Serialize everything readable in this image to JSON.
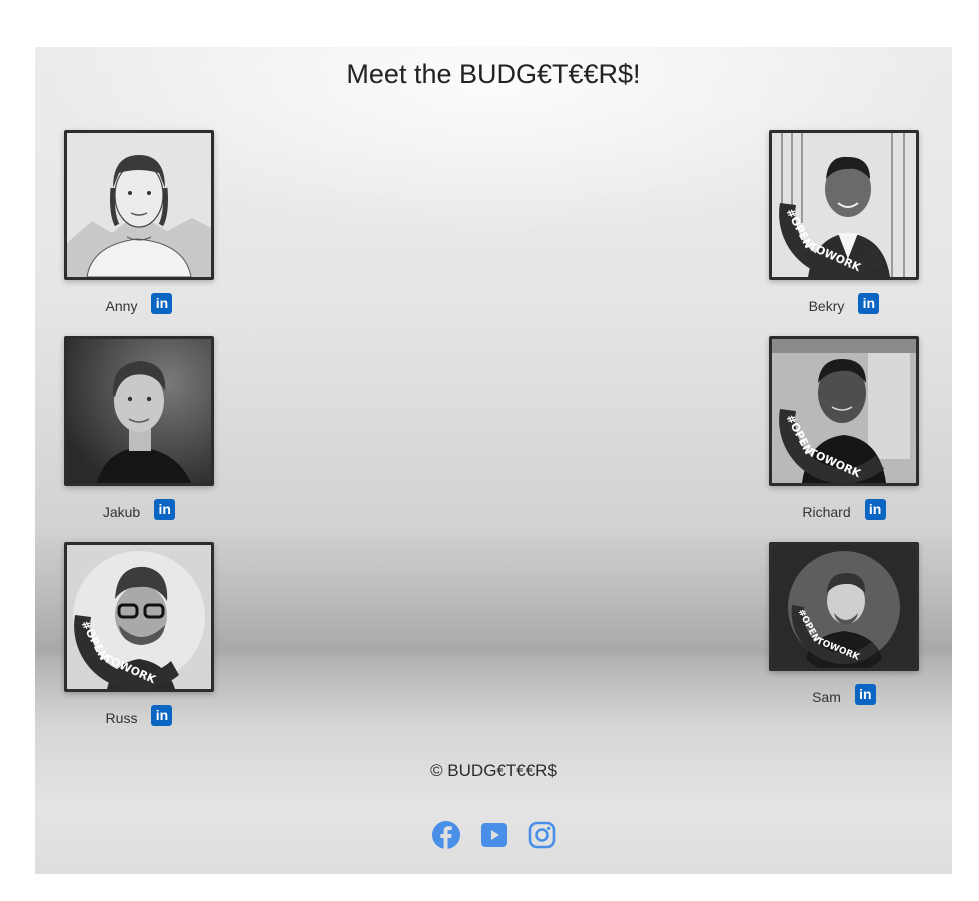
{
  "page": {
    "title": "Meet the BUDG€T€€R$!",
    "copyright": "© BUDG€T€€R$"
  },
  "members": [
    {
      "name": "Anny",
      "linkedin_icon": "linkedin-icon",
      "photo": "illustrated portrait"
    },
    {
      "name": "Jakub",
      "linkedin_icon": "linkedin-icon",
      "photo": "portrait"
    },
    {
      "name": "Russ",
      "linkedin_icon": "linkedin-icon",
      "photo": "portrait",
      "badge": "#OPENTOWORK"
    },
    {
      "name": "Bekry",
      "linkedin_icon": "linkedin-icon",
      "photo": "portrait",
      "badge": "#OPENTOWORK"
    },
    {
      "name": "Richard",
      "linkedin_icon": "linkedin-icon",
      "photo": "portrait",
      "badge": "#OPENTOWORK"
    },
    {
      "name": "Sam",
      "linkedin_icon": "linkedin-icon",
      "photo": "portrait",
      "badge": "#OPENTOWORK"
    }
  ],
  "social": {
    "icons": [
      "facebook-icon",
      "youtube-icon",
      "instagram-icon"
    ],
    "color": "#4a8fe7"
  },
  "colors": {
    "linkedin": "#0a66c2",
    "photo_border": "#2d2d2d"
  }
}
